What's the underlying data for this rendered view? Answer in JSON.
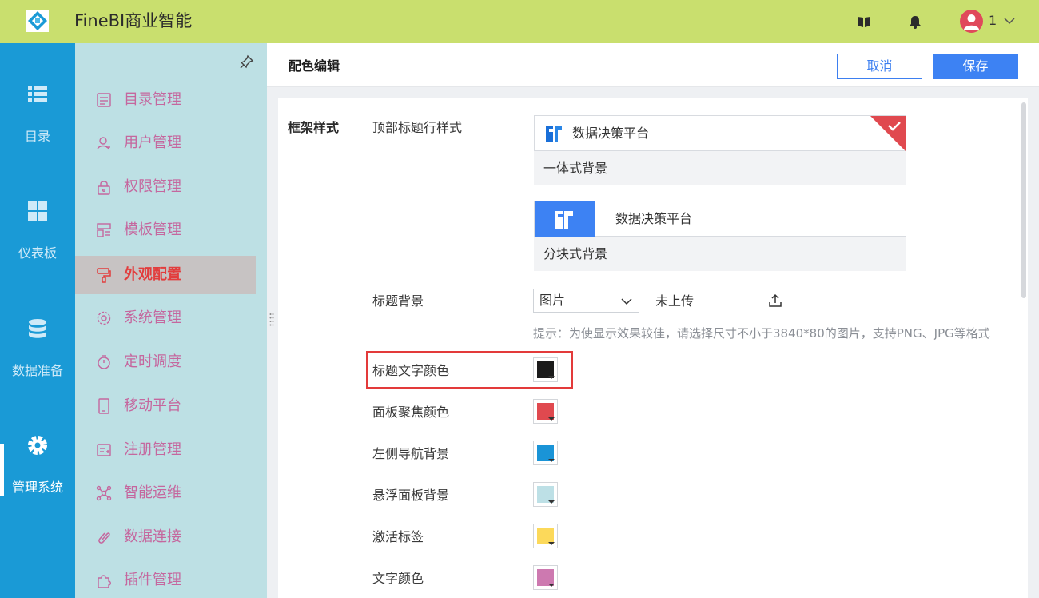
{
  "app": {
    "title": "FineBI商业智能",
    "user": "1"
  },
  "colors": {
    "topbar": "#c9df6e",
    "leftnav": "#1a9ad6",
    "submenu": "#bde0e4",
    "accent": "#3d82f3",
    "highlight": "#e33a3a"
  },
  "topbar_icons": [
    "book-icon",
    "bell-icon",
    "user-avatar-icon",
    "chevron-down-icon"
  ],
  "leftnav": {
    "items": [
      {
        "label": "目录",
        "icon": "list-icon"
      },
      {
        "label": "仪表板",
        "icon": "dashboard-icon"
      },
      {
        "label": "数据准备",
        "icon": "database-icon"
      },
      {
        "label": "管理系统",
        "icon": "gear-icon",
        "active": true
      }
    ]
  },
  "submenu": {
    "items": [
      {
        "label": "目录管理",
        "icon": "catalog-icon"
      },
      {
        "label": "用户管理",
        "icon": "user-icon"
      },
      {
        "label": "权限管理",
        "icon": "lock-icon"
      },
      {
        "label": "模板管理",
        "icon": "template-icon"
      },
      {
        "label": "外观配置",
        "icon": "paint-roller-icon",
        "active": true
      },
      {
        "label": "系统管理",
        "icon": "settings-icon"
      },
      {
        "label": "定时调度",
        "icon": "timer-icon"
      },
      {
        "label": "移动平台",
        "icon": "mobile-icon"
      },
      {
        "label": "注册管理",
        "icon": "register-icon"
      },
      {
        "label": "智能运维",
        "icon": "ops-icon"
      },
      {
        "label": "数据连接",
        "icon": "link-icon"
      },
      {
        "label": "插件管理",
        "icon": "plugin-icon"
      }
    ]
  },
  "main": {
    "title": "配色编辑",
    "cancel_label": "取消",
    "save_label": "保存",
    "section_label": "框架样式",
    "header_style": {
      "label": "顶部标题行样式",
      "options": [
        {
          "preview_title": "数据决策平台",
          "caption": "一体式背景",
          "selected": true
        },
        {
          "preview_title": "数据决策平台",
          "caption": "分块式背景",
          "selected": false
        }
      ]
    },
    "title_background": {
      "label": "标题背景",
      "select_value": "图片",
      "upload_status": "未上传",
      "hint": "提示：为使显示效果较佳，请选择尺寸不小于3840*80的图片，支持PNG、JPG等格式"
    },
    "color_settings": [
      {
        "label": "标题文字颜色",
        "color": "#1b1b1b",
        "highlighted": true
      },
      {
        "label": "面板聚焦颜色",
        "color": "#e0494f"
      },
      {
        "label": "左侧导航背景",
        "color": "#1a94d7"
      },
      {
        "label": "悬浮面板背景",
        "color": "#bde0e6"
      },
      {
        "label": "激活标签",
        "color": "#fcd95a"
      },
      {
        "label": "文字颜色",
        "color": "#cd79b0"
      }
    ]
  }
}
